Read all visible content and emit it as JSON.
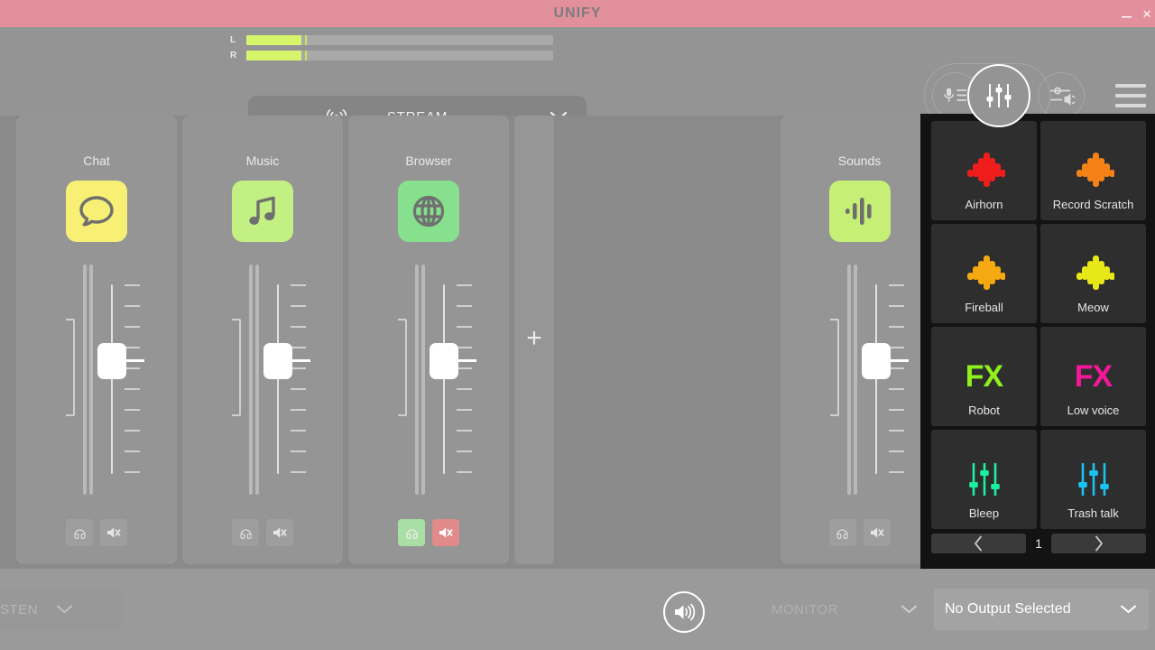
{
  "window": {
    "title": "UNIFY",
    "minimize_label": "–",
    "close_label": "×",
    "titlebar_color": "#e2909c"
  },
  "header": {
    "meters": [
      {
        "channel": "L",
        "level_percent": 18,
        "peak_percent": 19
      },
      {
        "channel": "R",
        "level_percent": 18,
        "peak_percent": 19
      }
    ],
    "tab": {
      "label": "STREAM",
      "wifi_icon": "broadcast-icon",
      "chevron_icon": "chevron-down-icon"
    },
    "icons": [
      {
        "name": "mic-list-icon",
        "active": false
      },
      {
        "name": "mixer-icon",
        "active": true
      },
      {
        "name": "output-level-icon",
        "active": false
      },
      {
        "name": "hamburger-menu-icon",
        "active": false
      }
    ]
  },
  "mixer": {
    "add_channel_label": "+",
    "channels": [
      {
        "name": "Chat",
        "icon": "chat-bubble-icon",
        "icon_color": "#f7f075",
        "volume_percent": 62,
        "listen_active": false,
        "mute_active": false,
        "listen_icon": "headphone-icon",
        "mute_icon": "speaker-mute-icon"
      },
      {
        "name": "Music",
        "icon": "music-note-icon",
        "icon_color": "#c3f083",
        "volume_percent": 62,
        "listen_active": false,
        "mute_active": false,
        "listen_icon": "headphone-icon",
        "mute_icon": "speaker-mute-icon"
      },
      {
        "name": "Browser",
        "icon": "globe-icon",
        "icon_color": "#86e08d",
        "volume_percent": 62,
        "listen_active": true,
        "mute_active": true,
        "listen_icon": "headphone-icon",
        "mute_icon": "speaker-mute-icon"
      },
      {
        "name": "Sounds",
        "icon": "waveform-icon",
        "icon_color": "#c6f075",
        "volume_percent": 62,
        "listen_active": false,
        "mute_active": false,
        "listen_icon": "headphone-icon",
        "mute_icon": "speaker-mute-icon"
      }
    ]
  },
  "soundboard": {
    "tiles": [
      {
        "label": "Airhorn",
        "art": "waveform",
        "color": "#f01d1d"
      },
      {
        "label": "Record Scratch",
        "art": "waveform",
        "color": "#f58217"
      },
      {
        "label": "Fireball",
        "art": "waveform",
        "color": "#f5a911"
      },
      {
        "label": "Meow",
        "art": "waveform",
        "color": "#e8e819"
      },
      {
        "label": "Robot",
        "art": "fx",
        "color": "#8ef01d"
      },
      {
        "label": "Low voice",
        "art": "fx",
        "color": "#f5179a"
      },
      {
        "label": "Bleep",
        "art": "sliders",
        "color": "#19f0a0"
      },
      {
        "label": "Trash talk",
        "art": "sliders",
        "color": "#19c3f0"
      }
    ],
    "pager": {
      "prev_label": "‹",
      "page": "1",
      "next_label": "›"
    }
  },
  "footer": {
    "listen_label": "STEN",
    "listen_chevron": "chevron-down-icon",
    "speaker_icon": "speaker-on-icon",
    "monitor_label": "MONITOR",
    "monitor_chevron": "chevron-down-icon",
    "output_label": "No Output Selected",
    "output_chevron": "chevron-down-icon"
  }
}
